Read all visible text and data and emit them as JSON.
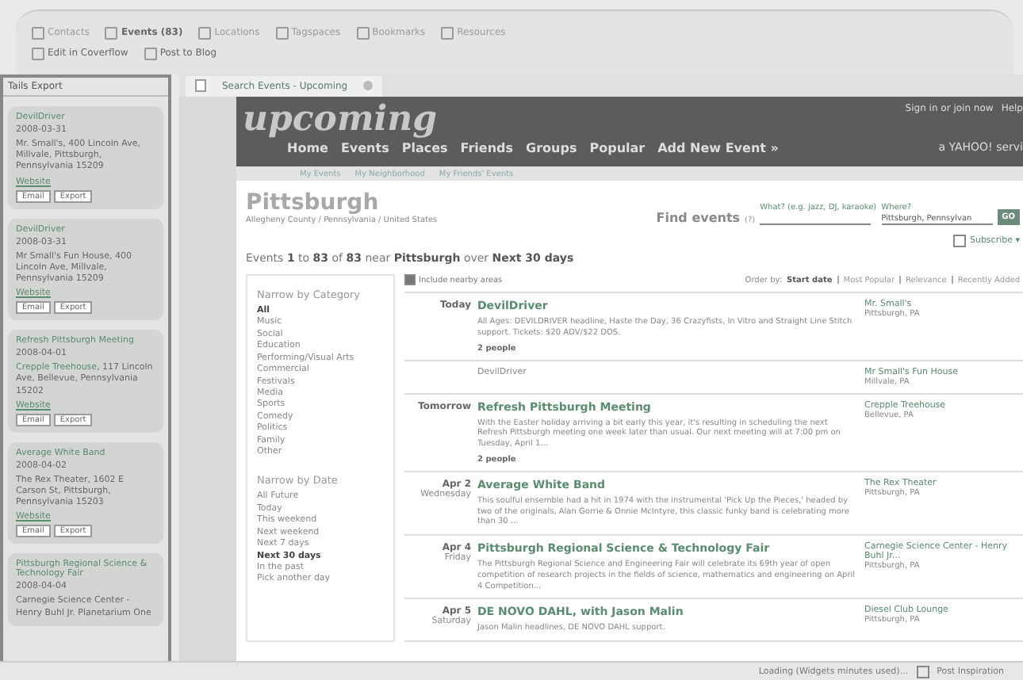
{
  "toolbar": {
    "tabs": [
      {
        "label": "Contacts",
        "selected": false
      },
      {
        "label": "Events (83)",
        "selected": true
      },
      {
        "label": "Locations",
        "selected": false
      },
      {
        "label": "Tagspaces",
        "selected": false
      },
      {
        "label": "Bookmarks",
        "selected": false
      },
      {
        "label": "Resources",
        "selected": false
      }
    ],
    "actions": [
      "Edit in Coverflow",
      "Post to Blog"
    ]
  },
  "sidebar": {
    "title": "Tails Export",
    "cards": [
      {
        "name": "DevilDriver",
        "date": "2008-03-31",
        "address": "Mr. Small's, 400 Lincoln Ave, Millvale, Pittsburgh, Pennsylvania 15209",
        "link": "Website",
        "buttons": [
          "Email",
          "Export"
        ]
      },
      {
        "name": "DevilDriver",
        "date": "2008-03-31",
        "address": "Mr Small's Fun House, 400 Lincoln Ave, Millvale, Pennsylvania 15209",
        "link": "Website",
        "buttons": [
          "Email",
          "Export"
        ]
      },
      {
        "name": "Refresh Pittsburgh Meeting",
        "date": "2008-04-01",
        "venue": "Crepple Treehouse",
        "address": ", 117 Lincoln Ave, Bellevue, Pennsylvania 15202",
        "link": "Website",
        "buttons": [
          "Email",
          "Export"
        ]
      },
      {
        "name": "Average White Band",
        "date": "2008-04-02",
        "address": "The Rex Theater, 1602 E Carson St, Pittsburgh, Pennsylvania 15203",
        "link": "Website",
        "buttons": [
          "Email",
          "Export"
        ]
      },
      {
        "name": "Pittsburgh Regional Science & Technology Fair",
        "date": "2008-04-04",
        "address": "Carnegie Science Center - Henry Buhl Jr. Planetarium One"
      }
    ]
  },
  "browser_tab": {
    "title": "Search Events - Upcoming"
  },
  "page": {
    "logo": "upcoming",
    "account_links": [
      "Sign in or join now",
      "Help"
    ],
    "yahoo": "a YAHOO! servi",
    "nav": [
      "Home",
      "Events",
      "Places",
      "Friends",
      "Groups",
      "Popular",
      "Add New Event »"
    ],
    "subnav": [
      "My Events",
      "My Neighborhood",
      "My Friends' Events"
    ],
    "place": {
      "name": "Pittsburgh",
      "breadcrumb": "Allegheny County / Pennsylvania / United States"
    },
    "find": {
      "label": "Find events",
      "help": "(?)",
      "what_label": "What? (e.g. jazz, DJ, karaoke)",
      "where_label": "Where?",
      "where_value": "Pittsburgh, Pennsylvan",
      "button": "GO"
    },
    "subscribe": "Subscribe ▾",
    "summary": "Events **1** to **83** of **83** near **Pittsburgh** over **Next 30 days**",
    "narrow": [
      {
        "title": "Narrow by Category",
        "items": [
          {
            "label": "All",
            "selected": true
          },
          {
            "label": "Music",
            "selected": false
          },
          {
            "label": "Social",
            "selected": false
          },
          {
            "label": "Education",
            "selected": false
          },
          {
            "label": "Performing/Visual Arts",
            "selected": false
          },
          {
            "label": "Commercial",
            "selected": false
          },
          {
            "label": "Festivals",
            "selected": false
          },
          {
            "label": "Media",
            "selected": false
          },
          {
            "label": "Sports",
            "selected": false
          },
          {
            "label": "Comedy",
            "selected": false
          },
          {
            "label": "Politics",
            "selected": false
          },
          {
            "label": "Family",
            "selected": false
          },
          {
            "label": "Other",
            "selected": false
          }
        ]
      },
      {
        "title": "Narrow by Date",
        "items": [
          {
            "label": "All Future",
            "selected": false
          },
          {
            "label": "Today",
            "selected": false
          },
          {
            "label": "This weekend",
            "selected": false
          },
          {
            "label": "Next weekend",
            "selected": false
          },
          {
            "label": "Next 7 days",
            "selected": false
          },
          {
            "label": "Next 30 days",
            "selected": true
          },
          {
            "label": "In the past",
            "selected": false
          },
          {
            "label": "Pick another day",
            "selected": false
          }
        ]
      }
    ],
    "nearby": {
      "label": "Include nearby areas",
      "checked": true
    },
    "order": {
      "label": "Order by:",
      "options": [
        {
          "label": "Start date",
          "selected": true
        },
        {
          "label": "Most Popular",
          "selected": false
        },
        {
          "label": "Relevance",
          "selected": false
        },
        {
          "label": "Recently Added",
          "selected": false
        }
      ]
    },
    "events": [
      {
        "date": "Today",
        "kind": "link",
        "title": "DevilDriver",
        "description": "All Ages: DEVILDRIVER headline, Haste the Day, 36 Crazyfists, In Vitro and Straight Line Stitch support. Tickets: $20 ADV/$22 DOS.",
        "attendees": "2 people",
        "venue": "Mr. Small's",
        "city": "Pittsburgh, PA"
      },
      {
        "kind": "plain",
        "title": "DevilDriver",
        "venue": "Mr Small's Fun House",
        "city": "Millvale, PA"
      },
      {
        "date": "Tomorrow",
        "kind": "link",
        "title": "Refresh Pittsburgh Meeting",
        "description": "With the Easter holiday arriving a bit early this year, it's resulting in scheduling the next Refresh Pittsburgh meeting one week later than usual. Our next meeting will at 7:00 pm on Tuesday, April 1...",
        "attendees": "2 people",
        "venue": "Crepple Treehouse",
        "city": "Bellevue, PA"
      },
      {
        "date": "Apr 2",
        "weekday": "Wednesday",
        "kind": "link",
        "title": "Average White Band",
        "description": "This soulful ensemble had a hit in 1974 with the instrumental 'Pick Up the Pieces,' headed by two of the originals, Alan Gorrie & Onnie McIntyre, this classic funky band is celebrating more than 30 ...",
        "venue": "The Rex Theater",
        "city": "Pittsburgh, PA"
      },
      {
        "date": "Apr 4",
        "weekday": "Friday",
        "kind": "link",
        "title": "Pittsburgh Regional Science & Technology Fair",
        "description": "The Pittsburgh Regional Science and Engineering Fair will celebrate its 69th year of open competition of research projects in the fields of science, mathematics and engineering on April 4 Competition...",
        "venue": "Carnegie Science Center - Henry Buhl Jr...",
        "city": "Pittsburgh, PA"
      },
      {
        "date": "Apr 5",
        "weekday": "Saturday",
        "kind": "link",
        "title": "DE NOVO DAHL, with Jason Malin",
        "description": "Jason Malin headlines, DE NOVO DAHL support.",
        "venue": "Diesel Club Lounge",
        "city": "Pittsburgh, PA"
      }
    ]
  },
  "status_bar": {
    "text": "Loading (Widgets minutes used)...",
    "right": "Post Inspiration"
  }
}
